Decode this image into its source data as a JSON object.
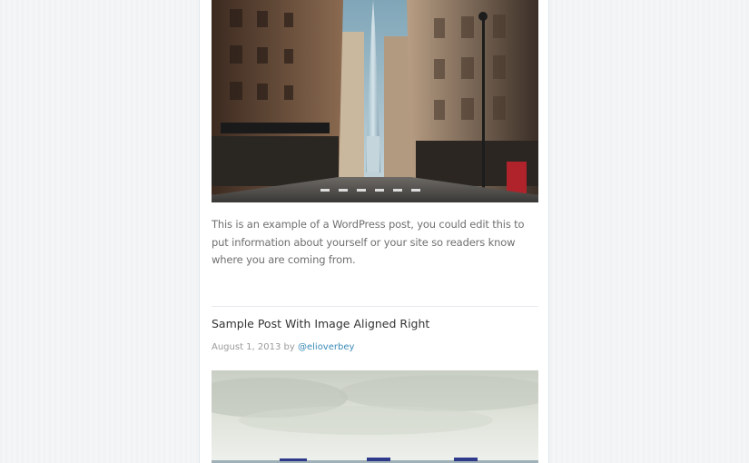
{
  "post_one": {
    "image_alt": "City street with skyscraper",
    "excerpt": "This is an example of a WordPress post, you could edit this to put information about yourself or your site so readers know where you are coming from."
  },
  "post_two": {
    "title": "Sample Post With Image Aligned Right",
    "date": "August 1, 2013",
    "by": "by",
    "author": "@elioverbey",
    "image_alt": "Sea horizon with ships"
  },
  "colors": {
    "background": "#f3f5f7",
    "content": "#ffffff",
    "link": "#3b8ab8",
    "text": "#6f6f6f",
    "title": "#333333"
  }
}
